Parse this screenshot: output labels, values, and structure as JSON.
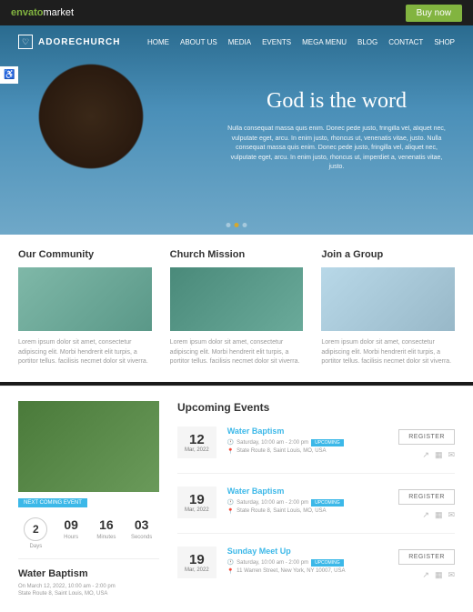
{
  "topbar": {
    "brand1": "envato",
    "brand2": "market",
    "buy": "Buy now"
  },
  "logo": "ADORECHURCH",
  "nav": [
    "HOME",
    "ABOUT US",
    "MEDIA",
    "EVENTS",
    "MEGA MENU",
    "BLOG",
    "CONTACT",
    "SHOP"
  ],
  "hero": {
    "title": "God is the word",
    "sub": "Nulla consequat massa quis enim. Donec pede justo, fringilla vel, aliquet nec, vulputate eget, arcu. In enim justo, rhoncus ut, venenatis vitae, justo. Nulla consequat massa quis enim. Donec pede justo, fringilla vel, aliquet nec, vulputate eget, arcu. In enim justo, rhoncus ut, imperdiet a, venenatis vitae, justo."
  },
  "features": [
    {
      "title": "Our Community",
      "desc": "Lorem ipsum dolor sit amet, consectetur adipiscing elit. Morbi hendrerit elit turpis, a portitor tellus. facilisis necmet dolor sit viverra."
    },
    {
      "title": "Church Mission",
      "desc": "Lorem ipsum dolor sit amet, consectetur adipiscing elit. Morbi hendrerit elit turpis, a portitor tellus. facilisis necmet dolor sit viverra."
    },
    {
      "title": "Join a Group",
      "desc": "Lorem ipsum dolor sit amet, consectetur adipiscing elit. Morbi hendrerit elit turpis, a portitor tellus. facilisis necmet dolor sit viverra."
    }
  ],
  "next_label": "NEXT COMING EVENT",
  "countdown": [
    {
      "n": "2",
      "l": "Days"
    },
    {
      "n": "09",
      "l": "Hours"
    },
    {
      "n": "16",
      "l": "Minutes"
    },
    {
      "n": "03",
      "l": "Seconds"
    }
  ],
  "featured": {
    "title": "Water Baptism",
    "line1": "On March 12, 2022, 10:00 am - 2:00 pm",
    "line2": "State Route 8, Saint Louis, MO, USA"
  },
  "upcoming_title": "Upcoming Events",
  "events": [
    {
      "day": "12",
      "mon": "Mar, 2022",
      "title": "Water Baptism",
      "time": "Saturday, 10:00 am - 2:00 pm",
      "badge": "UPCOMING",
      "loc": "State Route 8, Saint Louis, MO, USA",
      "reg": "REGISTER"
    },
    {
      "day": "19",
      "mon": "Mar, 2022",
      "title": "Water Baptism",
      "time": "Saturday, 10:00 am - 2:00 pm",
      "badge": "UPCOMING",
      "loc": "State Route 8, Saint Louis, MO, USA",
      "reg": "REGISTER"
    },
    {
      "day": "19",
      "mon": "Mar, 2022",
      "title": "Sunday Meet Up",
      "time": "Saturday, 10:00 am - 2:00 pm",
      "badge": "UPCOMING",
      "loc": "11 Warren Street, New York, NY 10007, USA",
      "reg": "REGISTER"
    }
  ]
}
